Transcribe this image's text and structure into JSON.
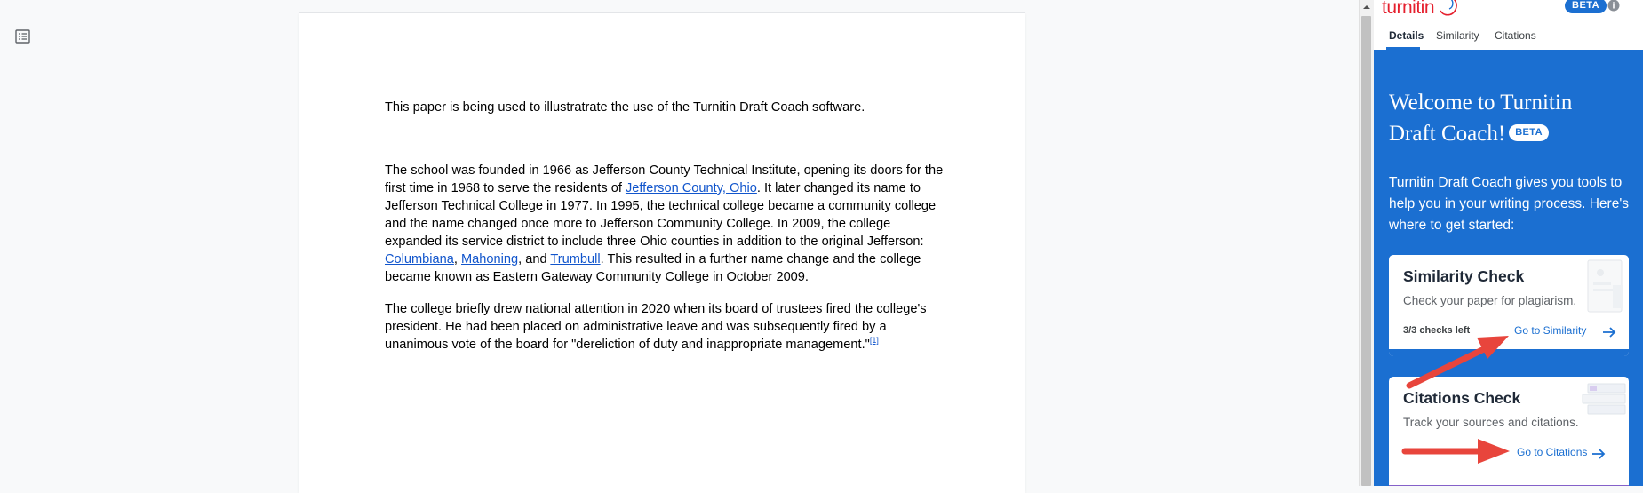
{
  "document": {
    "intro": "This paper is being used to illustratrate the use of the Turnitin Draft Coach software.",
    "p1": {
      "a": "The school was founded in 1966 as Jefferson County Technical Institute, opening its doors for the first time in 1968 to serve the residents of ",
      "link1": "Jefferson County, Ohio",
      "b": ". It later changed its name to Jefferson Technical College in 1977. In 1995, the technical college became a community college and the name changed once more to Jefferson Community College. In 2009, the college expanded its service district to include three Ohio counties in addition to the original Jefferson: ",
      "link2": "Columbiana",
      "c": ", ",
      "link3": "Mahoning",
      "d": ", and ",
      "link4": "Trumbull",
      "e": ". This resulted in a further name change and the college became known as Eastern Gateway Community College in October 2009."
    },
    "p2": {
      "text": "The college briefly drew national attention in 2020 when its board of trustees fired the college's president. He had been placed on administrative leave and was subsequently fired by a unanimous vote of the board for \"dereliction of duty and inappropriate management.\"",
      "footnote": "[1]"
    },
    "outline_icon": "document-outline-icon"
  },
  "panel": {
    "logo": "turnitin",
    "beta": "BETA",
    "info_icon": "info-icon",
    "tabs": [
      "Details",
      "Similarity",
      "Citations"
    ],
    "active_tab": "Details",
    "welcome_title": "Welcome to Turnitin Draft Coach!",
    "welcome_beta": "BETA",
    "welcome_desc": "Turnitin Draft Coach gives you tools to help you in your writing process. Here's where to get started:",
    "similarity": {
      "title": "Similarity Check",
      "desc": "Check your paper for plagiarism.",
      "count": "3/3 checks left",
      "link": "Go to Similarity",
      "accent": "#1b6fd1"
    },
    "citations": {
      "title": "Citations Check",
      "desc": "Track your sources and citations.",
      "link": "Go to Citations",
      "accent": "#8561c9"
    }
  },
  "colors": {
    "brand_blue": "#1b6fd1",
    "logo_red": "#e5202e",
    "annotation_red": "#e8453c"
  }
}
